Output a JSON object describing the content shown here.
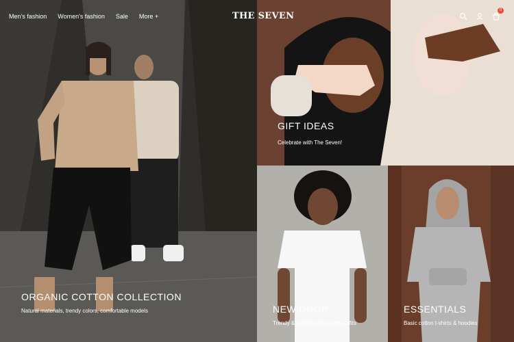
{
  "header": {
    "nav": [
      {
        "label": "Men's fashion"
      },
      {
        "label": "Women's fashion"
      },
      {
        "label": "Sale"
      },
      {
        "label": "More +"
      }
    ],
    "logo": "THE SEVEN",
    "cart_count": "0"
  },
  "tiles": {
    "organic": {
      "title": "ORGANIC COTTON COLLECTION",
      "subtitle": "Natural materials, trendy colors, comfortable models"
    },
    "gift": {
      "title": "GIFT IDEAS",
      "subtitle": "Celebrate with The Seven!"
    },
    "newdrop": {
      "title": "NEW DROP",
      "subtitle": "Trendy & comfortable home outfits"
    },
    "essentials": {
      "title": "ESSENTIALS",
      "subtitle": "Basic cotton t-shirts & hoodies"
    }
  },
  "icons": [
    "search-icon",
    "user-icon",
    "cart-icon"
  ]
}
